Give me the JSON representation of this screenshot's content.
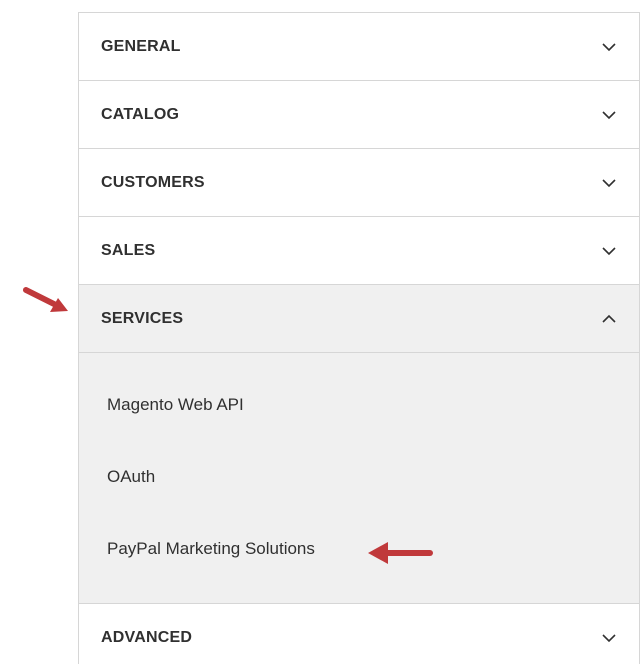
{
  "sections": [
    {
      "label": "GENERAL",
      "expanded": false
    },
    {
      "label": "CATALOG",
      "expanded": false
    },
    {
      "label": "CUSTOMERS",
      "expanded": false
    },
    {
      "label": "SALES",
      "expanded": false
    },
    {
      "label": "SERVICES",
      "expanded": true
    },
    {
      "label": "ADVANCED",
      "expanded": false
    }
  ],
  "services_items": [
    {
      "label": "Magento Web API"
    },
    {
      "label": "OAuth"
    },
    {
      "label": "PayPal Marketing Solutions"
    }
  ],
  "colors": {
    "border": "#d6d6d6",
    "open_bg": "#f0f0f0",
    "text": "#303030",
    "annotation_arrow": "#c0393b"
  },
  "icons": {
    "collapsed": "chevron-down-icon",
    "expanded": "chevron-up-icon",
    "annotation": "arrow-annotation"
  }
}
